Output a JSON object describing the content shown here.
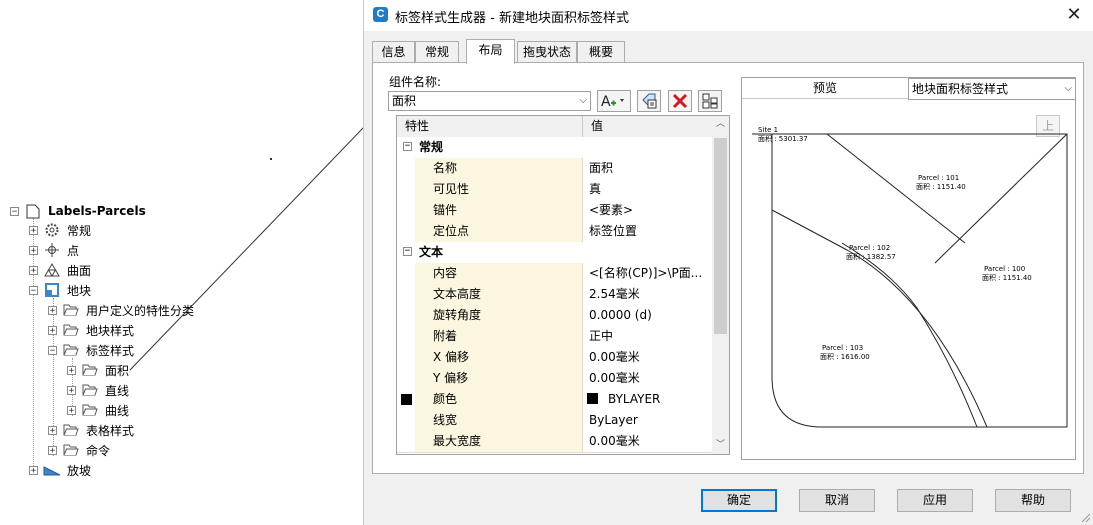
{
  "tree": {
    "root": "Labels-Parcels",
    "items": [
      {
        "label": "常规",
        "icon": "gear-icon",
        "level": 1,
        "expander": "+"
      },
      {
        "label": "点",
        "icon": "point-icon",
        "level": 1,
        "expander": "+"
      },
      {
        "label": "曲面",
        "icon": "surface-icon",
        "level": 1,
        "expander": "+"
      },
      {
        "label": "地块",
        "icon": "parcel-icon",
        "level": 1,
        "expander": "-"
      },
      {
        "label": "用户定义的特性分类",
        "icon": "folder-icon",
        "level": 2,
        "expander": "+"
      },
      {
        "label": "地块样式",
        "icon": "folder-icon",
        "level": 2,
        "expander": "+"
      },
      {
        "label": "标签样式",
        "icon": "folder-icon",
        "level": 2,
        "expander": "-"
      },
      {
        "label": "面积",
        "icon": "folder-icon",
        "level": 3,
        "expander": "+"
      },
      {
        "label": "直线",
        "icon": "folder-icon",
        "level": 3,
        "expander": "+"
      },
      {
        "label": "曲线",
        "icon": "folder-icon",
        "level": 3,
        "expander": "+"
      },
      {
        "label": "表格样式",
        "icon": "folder-icon",
        "level": 2,
        "expander": "+"
      },
      {
        "label": "命令",
        "icon": "folder-icon",
        "level": 2,
        "expander": "+"
      },
      {
        "label": "放坡",
        "icon": "grading-icon",
        "level": 1,
        "expander": "+"
      }
    ]
  },
  "dialog": {
    "title": "标签样式生成器 - 新建地块面积标签样式",
    "tabs": [
      "信息",
      "常规",
      "布局",
      "拖曳状态",
      "概要"
    ],
    "active_tab": "布局",
    "component_name_label": "组件名称:",
    "component_name_value": "面积",
    "grid": {
      "col_property": "特性",
      "col_value": "值",
      "categories": [
        {
          "name": "常规",
          "rows": [
            {
              "k": "名称",
              "v": "面积"
            },
            {
              "k": "可见性",
              "v": "真"
            },
            {
              "k": "锚件",
              "v": "<要素>"
            },
            {
              "k": "定位点",
              "v": "标签位置"
            }
          ]
        },
        {
          "name": "文本",
          "rows": [
            {
              "k": "内容",
              "v": "<[名称(CP)]>\\P面..."
            },
            {
              "k": "文本高度",
              "v": "2.54毫米"
            },
            {
              "k": "旋转角度",
              "v": "0.0000 (d)"
            },
            {
              "k": "附着",
              "v": "正中"
            },
            {
              "k": "X 偏移",
              "v": "0.00毫米"
            },
            {
              "k": "Y 偏移",
              "v": "0.00毫米"
            },
            {
              "k": "颜色",
              "v": "BYLAYER"
            },
            {
              "k": "线宽",
              "v": "ByLayer"
            },
            {
              "k": "最大宽度",
              "v": "0.00毫米"
            }
          ]
        }
      ]
    },
    "preview": {
      "label": "预览",
      "style_select": "地块面积标签样式",
      "up_button": "上",
      "site_label": "Site 1",
      "site_area": "面积 : 5301.37",
      "parcels": [
        {
          "name": "Parcel : 101",
          "area": "面积 : 1151.40"
        },
        {
          "name": "Parcel : 102",
          "area": "面积 : 1382.57"
        },
        {
          "name": "Parcel : 100",
          "area": "面积 : 1151.40"
        },
        {
          "name": "Parcel : 103",
          "area": "面积 : 1616.00"
        }
      ]
    },
    "buttons": {
      "ok": "确定",
      "cancel": "取消",
      "apply": "应用",
      "help": "帮助"
    }
  }
}
